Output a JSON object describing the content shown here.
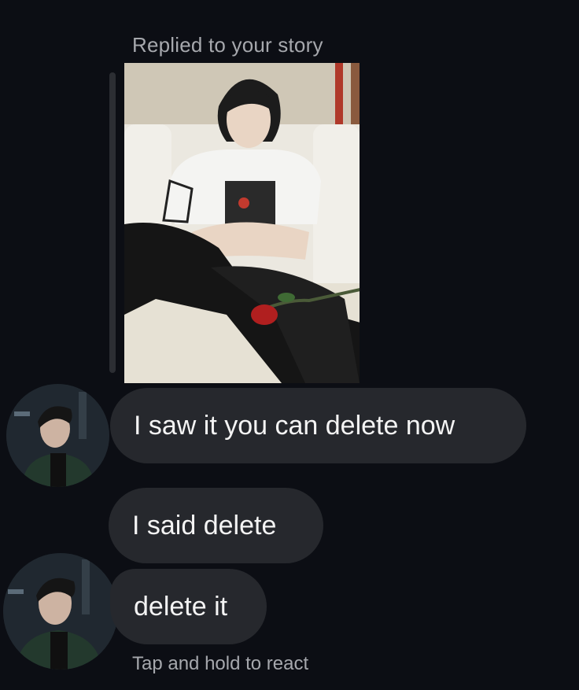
{
  "story_reply": {
    "label": "Replied to your story"
  },
  "messages": [
    {
      "text": "I saw it you can delete now"
    },
    {
      "text": "I said delete"
    },
    {
      "text": "delete it"
    }
  ],
  "footer": {
    "hint": "Tap and hold to react"
  },
  "colors": {
    "background": "#0c0e14",
    "bubble": "#26282d",
    "secondary_text": "#a6a8ad",
    "reply_bar": "#2c2e33"
  }
}
